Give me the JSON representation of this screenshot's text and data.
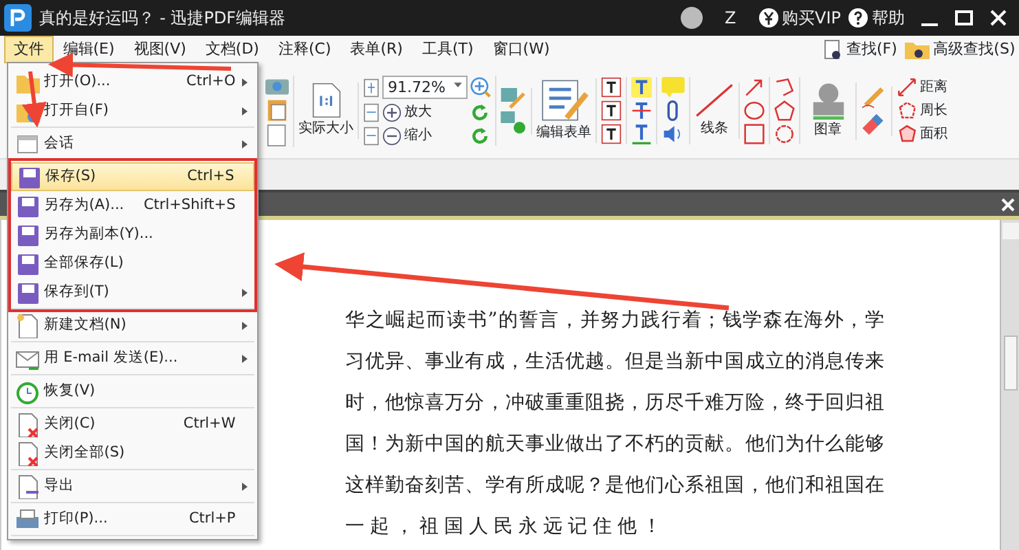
{
  "window": {
    "title": "真的是好运吗？ - 迅捷PDF编辑器",
    "user": "Z",
    "buttons": [
      "购买VIP",
      "帮助"
    ]
  },
  "menu_bar": [
    {
      "label": "文件",
      "selected": true
    },
    {
      "label": "编辑(E)",
      "selected": false
    },
    {
      "label": "视图(V)",
      "selected": false
    },
    {
      "label": "文档(D)",
      "selected": false
    },
    {
      "label": "注释(C)",
      "selected": false
    },
    {
      "label": "表单(R)",
      "selected": false
    },
    {
      "label": "工具(T)",
      "selected": false
    },
    {
      "label": "窗口(W)",
      "selected": false
    }
  ],
  "search": [
    "查找(F)",
    "高级查找(S)"
  ],
  "toolbar": {
    "zoom_value": "91.72%",
    "actual_size": "实际大小",
    "zoom_in": "放大",
    "zoom_out": "缩小",
    "edit_form": "编辑表单",
    "lines": "线条",
    "stamp": "图章",
    "distance": "距离",
    "perimeter": "周长",
    "area": "面积"
  },
  "file_menu": [
    {
      "outlined": false,
      "items": [
        {
          "label": "打开(O)...",
          "shortcut": "Ctrl+O",
          "submenu": true,
          "highlighted": false
        },
        {
          "label": "打开自(F)",
          "submenu": true,
          "highlighted": false
        }
      ]
    },
    {
      "outlined": false,
      "items": [
        {
          "label": "会话",
          "submenu": true,
          "highlighted": false
        }
      ]
    },
    {
      "outlined": true,
      "items": [
        {
          "label": "保存(S)",
          "shortcut": "Ctrl+S",
          "submenu": false,
          "highlighted": true
        },
        {
          "label": "另存为(A)...",
          "shortcut": "Ctrl+Shift+S",
          "submenu": false,
          "highlighted": false
        },
        {
          "label": "另存为副本(Y)...",
          "submenu": false,
          "highlighted": false
        },
        {
          "label": "全部保存(L)",
          "submenu": false,
          "highlighted": false
        },
        {
          "label": "保存到(T)",
          "submenu": true,
          "highlighted": false
        }
      ]
    },
    {
      "outlined": false,
      "items": [
        {
          "label": "新建文档(N)",
          "submenu": true,
          "highlighted": false
        }
      ]
    },
    {
      "outlined": false,
      "items": [
        {
          "label": "用 E-mail 发送(E)...",
          "submenu": true,
          "highlighted": false
        }
      ]
    },
    {
      "outlined": false,
      "items": [
        {
          "label": "恢复(V)",
          "submenu": false,
          "highlighted": false
        }
      ]
    },
    {
      "outlined": false,
      "items": [
        {
          "label": "关闭(C)",
          "shortcut": "Ctrl+W",
          "submenu": false,
          "highlighted": false
        },
        {
          "label": "关闭全部(S)",
          "submenu": false,
          "highlighted": false
        }
      ]
    },
    {
      "outlined": false,
      "items": [
        {
          "label": "导出",
          "submenu": true,
          "highlighted": false
        }
      ]
    },
    {
      "outlined": false,
      "items": [
        {
          "label": "打印(P)...",
          "shortcut": "Ctrl+P",
          "submenu": false,
          "highlighted": false
        }
      ]
    }
  ],
  "document": {
    "lines": [
      "华之崛起而读书”的誓言，并努力践行着；钱学森在海外，学",
      "习优异、事业有成，生活优越。但是当新中国成立的消息传来",
      "时，他惊喜万分，冲破重重阻挠，历尽千难万险，终于回归祖",
      "国！为新中国的航天事业做出了不朽的贡献。他们为什么能够",
      "这样勤奋刻苦、学有所成呢？是他们心系祖国，他们和祖国在",
      "一起，祖国人民永远记住他！"
    ]
  }
}
